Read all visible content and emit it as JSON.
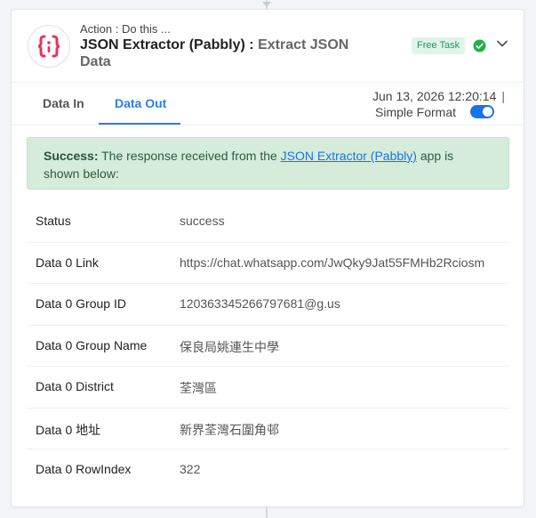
{
  "step": {
    "action_label": "Action : Do this ...",
    "app_name": "JSON Extractor (Pabbly) :",
    "event_name": "Extract JSON Data",
    "badge": "Free Task",
    "icon": "json-braces-icon",
    "status_icon": "check-circle-icon",
    "collapse_icon": "chevron-down-icon"
  },
  "tabs": [
    {
      "label": "Data In",
      "active": false
    },
    {
      "label": "Data Out",
      "active": true
    }
  ],
  "timestamp": "Jun 13, 2026 12:20:14",
  "timestamp_separator": "|",
  "simple_format": {
    "label": "Simple Format",
    "enabled": true
  },
  "alert": {
    "strong": "Success:",
    "text_before": " The response received from the ",
    "link": "JSON Extractor (Pabbly)",
    "text_after": " app is shown below:"
  },
  "rows": [
    {
      "key": "Status",
      "value": "success"
    },
    {
      "key": "Data 0 Link",
      "value": "https://chat.whatsapp.com/JwQky9Jat55FMHb2Rciosm"
    },
    {
      "key": "Data 0 Group ID",
      "value": "120363345266797681@g.us"
    },
    {
      "key": "Data 0 Group Name",
      "value": "保良局姚連生中學"
    },
    {
      "key": "Data 0 District",
      "value": "荃灣區"
    },
    {
      "key": "Data 0 地址",
      "value": "新界荃灣石圍角邨"
    },
    {
      "key": "Data 0 RowIndex",
      "value": "322"
    }
  ],
  "colors": {
    "accent": "#2b7de9",
    "brand_icon": "#e8345a",
    "success_bg": "#d5ecdb",
    "success_badge": "#1f9a5a",
    "status_check": "#22b04b"
  }
}
